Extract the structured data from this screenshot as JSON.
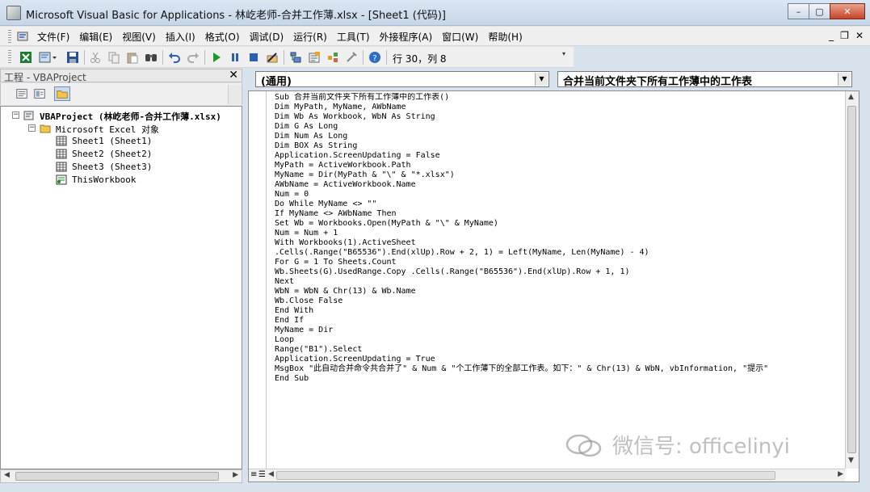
{
  "window": {
    "title": "Microsoft Visual Basic for Applications - 林屹老师-合并工作薄.xlsx - [Sheet1 (代码)]",
    "minimize": "–",
    "maximize": "▢",
    "close": "✕"
  },
  "menu": {
    "items": [
      "文件(F)",
      "编辑(E)",
      "视图(V)",
      "插入(I)",
      "格式(O)",
      "调试(D)",
      "运行(R)",
      "工具(T)",
      "外接程序(A)",
      "窗口(W)",
      "帮助(H)"
    ],
    "mdi_min": "_",
    "mdi_restore": "❐",
    "mdi_close": "✕"
  },
  "toolbar": {
    "position": "行 30，列 8",
    "icons": [
      "excel-icon",
      "insert-module-icon",
      "save-icon",
      "cut-icon",
      "copy-icon",
      "paste-icon",
      "find-icon",
      "undo-icon",
      "redo-icon",
      "run-icon",
      "break-icon",
      "reset-icon",
      "design-mode-icon",
      "project-explorer-icon",
      "properties-icon",
      "object-browser-icon",
      "toolbox-icon",
      "help-icon"
    ]
  },
  "project": {
    "title": "工程 - VBAProject",
    "close": "✕",
    "tree": {
      "root": "VBAProject (林屹老师-合并工作薄.xlsx)",
      "folder": "Microsoft Excel 对象",
      "items": [
        "Sheet1 (Sheet1)",
        "Sheet2 (Sheet2)",
        "Sheet3 (Sheet3)",
        "ThisWorkbook"
      ]
    }
  },
  "code": {
    "object_combo": "(通用)",
    "procedure_combo": "合并当前文件夹下所有工作薄中的工作表",
    "lines": [
      "Sub 合并当前文件夹下所有工作薄中的工作表()",
      "Dim MyPath, MyName, AWbName",
      "Dim Wb As Workbook, WbN As String",
      "Dim G As Long",
      "Dim Num As Long",
      "Dim BOX As String",
      "Application.ScreenUpdating = False",
      "MyPath = ActiveWorkbook.Path",
      "MyName = Dir(MyPath & \"\\\" & \"*.xlsx\")",
      "AWbName = ActiveWorkbook.Name",
      "Num = 0",
      "Do While MyName <> \"\"",
      "If MyName <> AWbName Then",
      "Set Wb = Workbooks.Open(MyPath & \"\\\" & MyName)",
      "Num = Num + 1",
      "With Workbooks(1).ActiveSheet",
      ".Cells(.Range(\"B65536\").End(xlUp).Row + 2, 1) = Left(MyName, Len(MyName) - 4)",
      "For G = 1 To Sheets.Count",
      "Wb.Sheets(G).UsedRange.Copy .Cells(.Range(\"B65536\").End(xlUp).Row + 1, 1)",
      "Next",
      "WbN = WbN & Chr(13) & Wb.Name",
      "Wb.Close False",
      "End With",
      "End If",
      "MyName = Dir",
      "Loop",
      "Range(\"B1\").Select",
      "Application.ScreenUpdating = True",
      "MsgBox \"此自动合并命令共合并了\" & Num & \"个工作薄下的全部工作表。如下：\" & Chr(13) & WbN, vbInformation, \"提示\"",
      "End Sub"
    ]
  },
  "watermark": {
    "text": "微信号: officelinyi"
  }
}
